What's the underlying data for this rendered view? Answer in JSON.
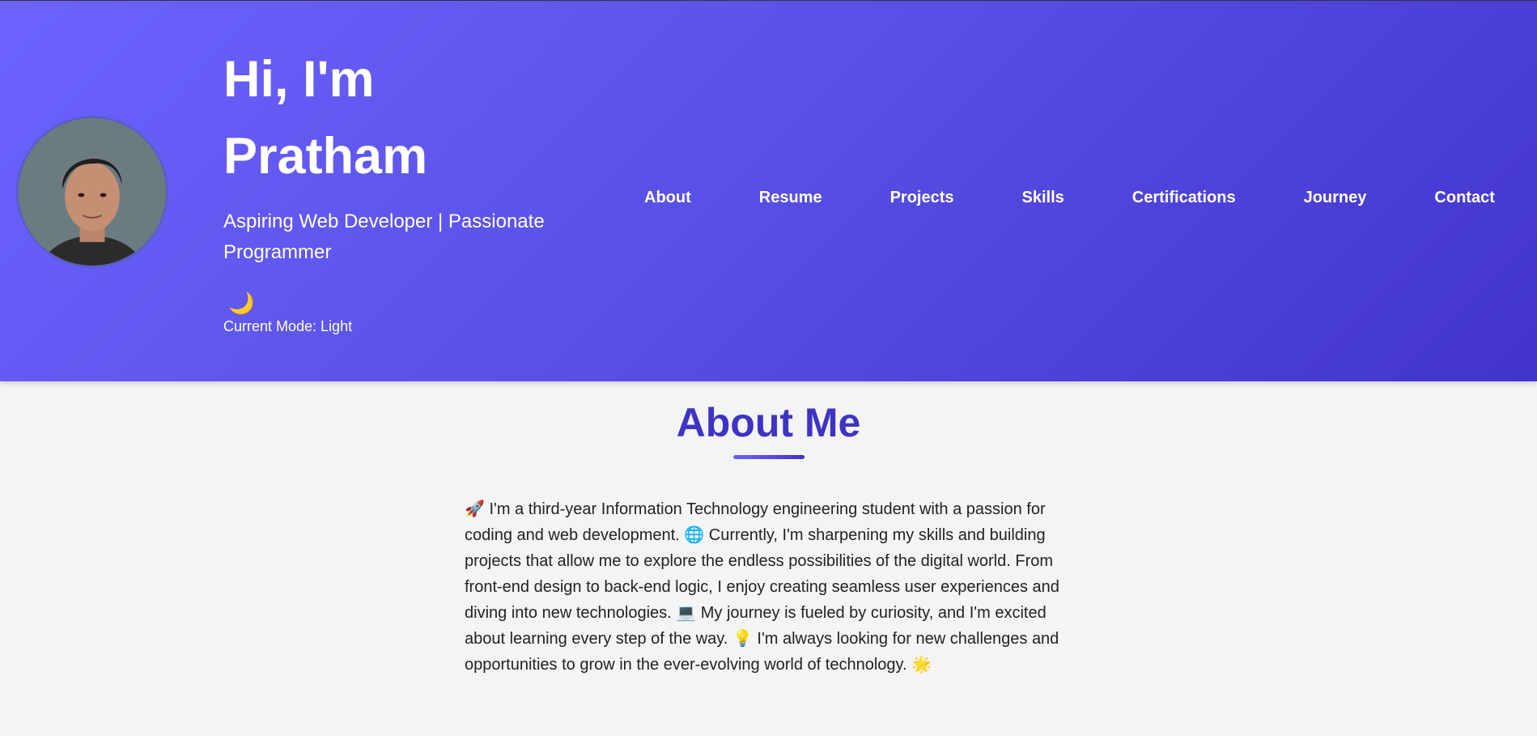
{
  "header": {
    "greeting_line1": "Hi, I'm",
    "greeting_line2": "Pratham",
    "subtitle": "Aspiring Web Developer | Passionate Programmer",
    "mode_toggle_icon": "🌙",
    "mode_label": "Current Mode: Light"
  },
  "nav": {
    "items": [
      {
        "label": "About"
      },
      {
        "label": "Resume"
      },
      {
        "label": "Projects"
      },
      {
        "label": "Skills"
      },
      {
        "label": "Certifications"
      },
      {
        "label": "Journey"
      },
      {
        "label": "Contact"
      }
    ]
  },
  "about": {
    "title": "About Me",
    "text": "🚀 I'm a third-year Information Technology engineering student with a passion for coding and web development. 🌐 Currently, I'm sharpening my skills and building projects that allow me to explore the endless possibilities of the digital world. From front-end design to back-end logic, I enjoy creating seamless user experiences and diving into new technologies. 💻 My journey is fueled by curiosity, and I'm excited about learning every step of the way. 💡 I'm always looking for new challenges and opportunities to grow in the ever-evolving world of technology. 🌟"
  },
  "colors": {
    "header_gradient_start": "#6c63ff",
    "header_gradient_end": "#4234cc",
    "accent": "#3f33c4",
    "page_background": "#f3f4f6"
  },
  "icons": {
    "mode_toggle": "moon-icon",
    "avatar": "profile-photo"
  }
}
